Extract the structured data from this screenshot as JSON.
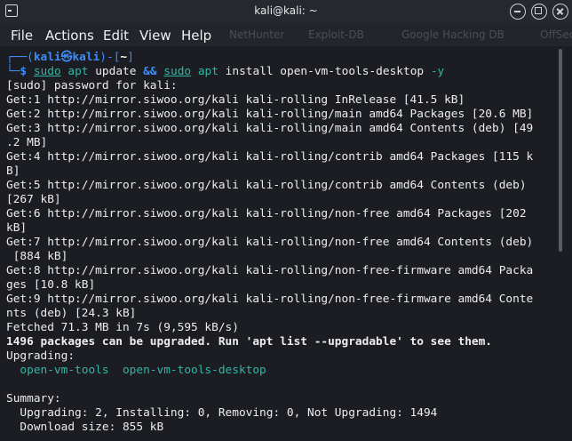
{
  "window": {
    "title": "kali@kali: ~",
    "icon": "terminal-icon",
    "controls": [
      "minimize-icon",
      "maximize-icon",
      "close-icon"
    ]
  },
  "menu": [
    "File",
    "Actions",
    "Edit",
    "View",
    "Help"
  ],
  "background_tabs": [
    "NetHunter",
    "Exploit-DB",
    "Google Hacking DB",
    "OffSec"
  ],
  "prompt": {
    "open": "┌──(",
    "user": "kali",
    "at": "㉿",
    "host": "kali",
    "close": ")-[",
    "dir": "~",
    "end": "]",
    "second": "└─",
    "dollar": "$ ",
    "command": {
      "sudo1": "sudo",
      "apt1": "apt",
      "update": " update ",
      "and": "&&",
      "space": " ",
      "sudo2": "sudo",
      "apt2": "apt",
      "install": " install open-vm-tools-desktop ",
      "flag": "-y"
    }
  },
  "output": [
    "[sudo] password for kali:",
    "Get:1 http://mirror.siwoo.org/kali kali-rolling InRelease [41.5 kB]",
    "Get:2 http://mirror.siwoo.org/kali kali-rolling/main amd64 Packages [20.6 MB]",
    "Get:3 http://mirror.siwoo.org/kali kali-rolling/main amd64 Contents (deb) [49",
    ".2 MB]",
    "Get:4 http://mirror.siwoo.org/kali kali-rolling/contrib amd64 Packages [115 k",
    "B]",
    "Get:5 http://mirror.siwoo.org/kali kali-rolling/contrib amd64 Contents (deb)",
    "[267 kB]",
    "Get:6 http://mirror.siwoo.org/kali kali-rolling/non-free amd64 Packages [202",
    "kB]",
    "Get:7 http://mirror.siwoo.org/kali kali-rolling/non-free amd64 Contents (deb)",
    " [884 kB]",
    "Get:8 http://mirror.siwoo.org/kali kali-rolling/non-free-firmware amd64 Packa",
    "ges [10.8 kB]",
    "Get:9 http://mirror.siwoo.org/kali kali-rolling/non-free-firmware amd64 Conte",
    "nts (deb) [24.3 kB]",
    "Fetched 71.3 MB in 7s (9,595 kB/s)"
  ],
  "upgrade_notice": "1496 packages can be upgraded. Run 'apt list --upgradable' to see them.",
  "upgrading_label": "Upgrading:",
  "upgrading_packages": "  open-vm-tools  open-vm-tools-desktop",
  "summary_label": "Summary:",
  "summary_counts": "  Upgrading: 2, Installing: 0, Removing: 0, Not Upgrading: 1494",
  "summary_download": "  Download size: 855 kB",
  "colors": {
    "prompt_blue": "#3d8cf5",
    "package_teal": "#2fb7a6",
    "background": "#1b1d23"
  }
}
